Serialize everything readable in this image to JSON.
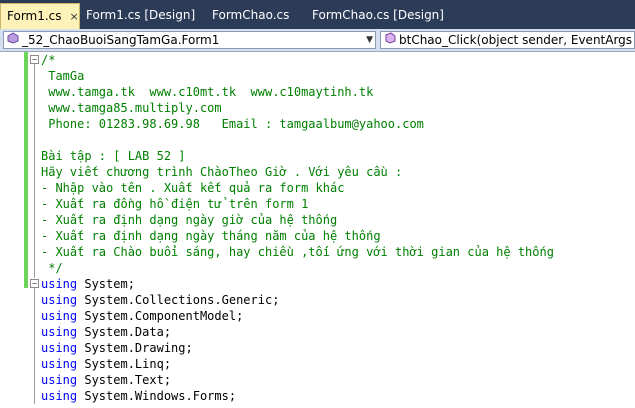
{
  "tabs": [
    {
      "label": "Form1.cs",
      "active": true
    },
    {
      "label": "Form1.cs [Design]",
      "active": false
    },
    {
      "label": "FormChao.cs",
      "active": false
    },
    {
      "label": "FormChao.cs [Design]",
      "active": false
    }
  ],
  "tab_close_glyph": "×",
  "navbar": {
    "class_combo": "_52_ChaoBuoiSangTamGa.Form1",
    "member_combo": "btChao_Click(object sender, EventArgs e)"
  },
  "code": {
    "comment_lines": [
      "/*",
      " TamGa",
      " www.tamga.tk  www.c10mt.tk  www.c10maytinh.tk",
      " www.tamga85.multiply.com",
      " Phone: 01283.98.69.98   Email : tamgaalbum@yahoo.com",
      "",
      "Bài tập : [ LAB 52 ]",
      "Hãy viết chương trình ChàoTheo Giờ . Với yêu cầu :",
      "- Nhập vào tên . Xuất kết quả ra form khác",
      "- Xuất ra đồng hồ điện tử trên form 1",
      "- Xuất ra định dạng ngày giờ của hệ thống",
      "- Xuất ra định dạng ngày tháng năm của hệ thống",
      "- Xuất ra Chào buổi sáng, hay chiều ,tối ứng với thời gian của hệ thống",
      " */"
    ],
    "using_keyword": "using",
    "usings": [
      " System;",
      " System.Collections.Generic;",
      " System.ComponentModel;",
      " System.Data;",
      " System.Drawing;",
      " System.Linq;",
      " System.Text;",
      " System.Windows.Forms;"
    ]
  },
  "colors": {
    "comment": "#008000",
    "keyword": "#0000ff",
    "changed_margin": "#6cd65a",
    "tab_strip": "#2b3b58",
    "active_tab": "#fdf3b8"
  }
}
